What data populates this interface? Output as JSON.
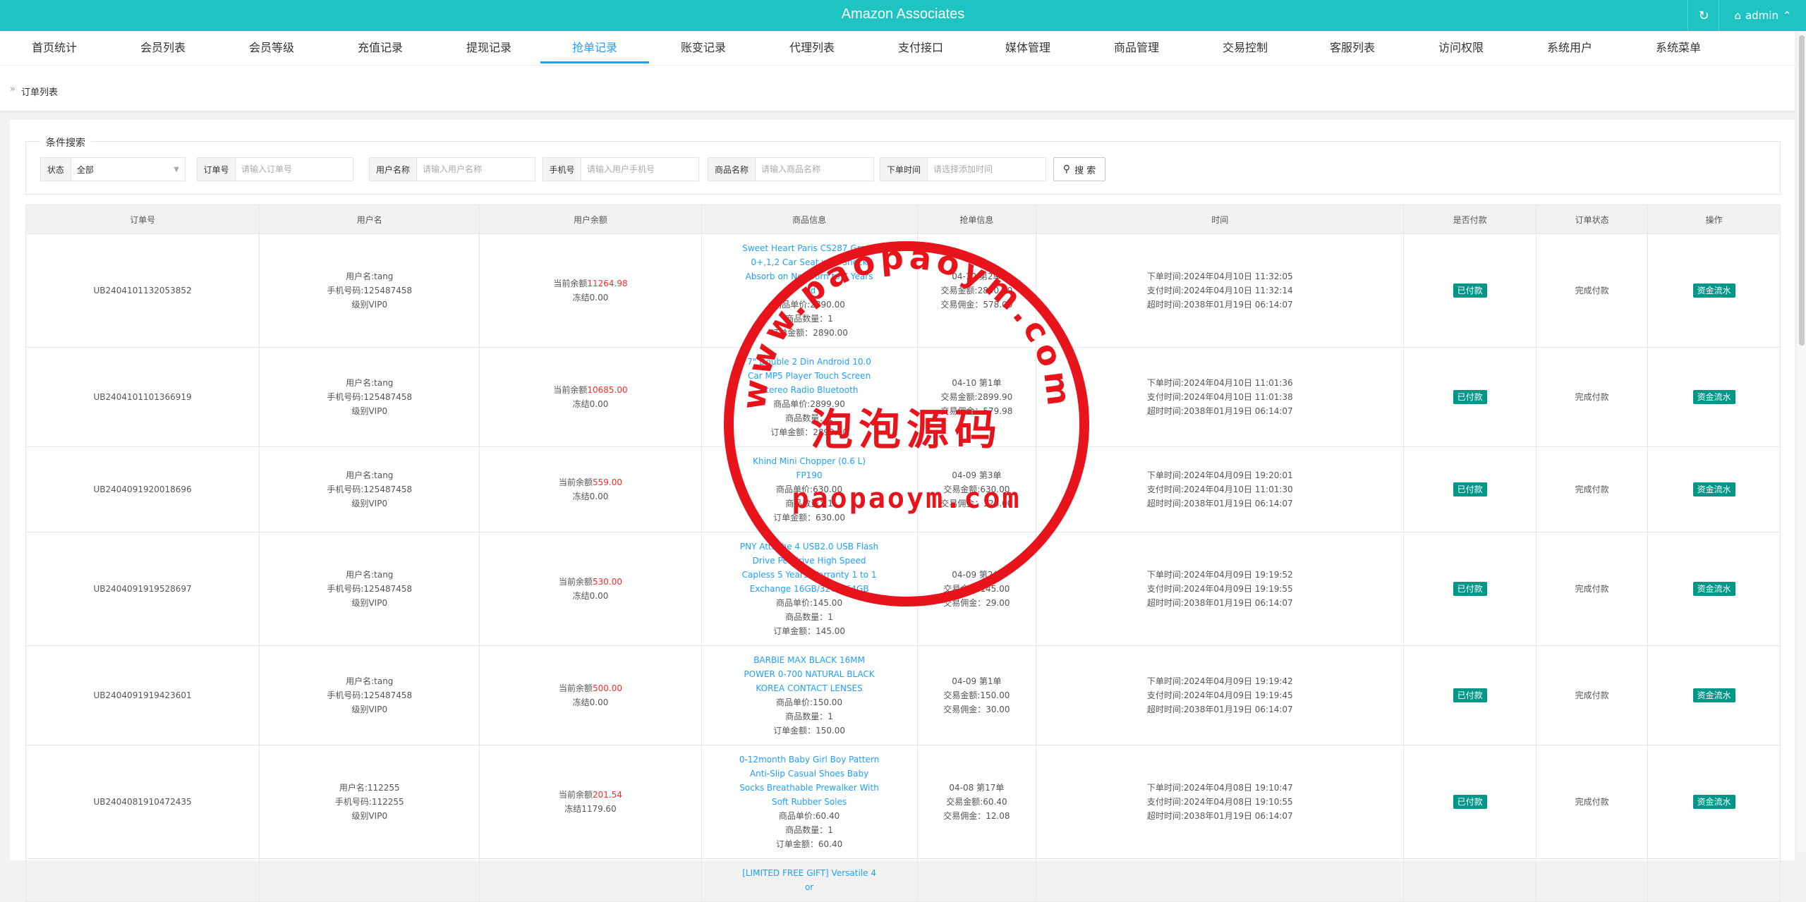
{
  "header": {
    "title": "Amazon Associates",
    "refresh_icon": "refresh-icon",
    "user_icon": "user-icon",
    "username": "admin",
    "chevron_icon": "chevron-up-icon",
    "bg_color": "#1ec4c1"
  },
  "nav": {
    "items": [
      {
        "label": "首页统计"
      },
      {
        "label": "会员列表"
      },
      {
        "label": "会员等级"
      },
      {
        "label": "充值记录"
      },
      {
        "label": "提现记录"
      },
      {
        "label": "抢单记录",
        "active": true
      },
      {
        "label": "账变记录"
      },
      {
        "label": "代理列表"
      },
      {
        "label": "支付接口"
      },
      {
        "label": "媒体管理"
      },
      {
        "label": "商品管理"
      },
      {
        "label": "交易控制"
      },
      {
        "label": "客服列表"
      },
      {
        "label": "访问权限"
      },
      {
        "label": "系统用户"
      },
      {
        "label": "系统菜单"
      }
    ],
    "active_color": "#1e9fff"
  },
  "breadcrumb": {
    "icon": "double-chevron-right-icon",
    "label": "订单列表"
  },
  "search": {
    "legend": "条件搜索",
    "status_label": "状态",
    "status_value": "全部",
    "order_label": "订单号",
    "order_placeholder": "请输入订单号",
    "username_label": "用户名称",
    "username_placeholder": "请输入用户名称",
    "phone_label": "手机号",
    "phone_placeholder": "请输入用户手机号",
    "product_label": "商品名称",
    "product_placeholder": "请输入商品名称",
    "time_label": "下单时间",
    "time_placeholder": "请选择添加时间",
    "button_label": "搜 索"
  },
  "table": {
    "headers": [
      "订单号",
      "用户名",
      "用户余额",
      "商品信息",
      "抢单信息",
      "时间",
      "是否付款",
      "订单状态",
      "操作"
    ],
    "rows": [
      {
        "order_no": "UB2404101132053852",
        "user": [
          "用户名:tang",
          "手机号码:125487458",
          "级别VIP0"
        ],
        "balance_label": "当前余额",
        "balance": "11264.98",
        "frozen": "冻结0.00",
        "product_name": "Sweet Heart Paris CS287 Group 0+,1,2 Car Seat with Shock Absorb on Newborn to 7 Years old",
        "product_lines": [
          "商品单价:2890.00",
          "商品数量：1",
          "订单金额：2890.00"
        ],
        "grab": [
          "04-10 第2单",
          "交易金额:2890.00",
          "交易佣金：578.00"
        ],
        "time": [
          "下单时间:2024年04月10日 11:32:05",
          "支付时间:2024年04月10日 11:32:14",
          "超时时间:2038年01月19日 06:14:07"
        ],
        "paid": "已付款",
        "status": "完成付款",
        "action": "资金流水"
      },
      {
        "order_no": "UB2404101101366919",
        "user": [
          "用户名:tang",
          "手机号码:125487458",
          "级别VIP0"
        ],
        "balance_label": "当前余额",
        "balance": "10685.00",
        "frozen": "冻结0.00",
        "product_name": "7\" Double 2 Din Android 10.0 Car MP5 Player Touch Screen Stereo Radio Bluetooth",
        "product_lines": [
          "商品单价:2899.90",
          "商品数量：1",
          "订单金额：2899.90"
        ],
        "grab": [
          "04-10 第1单",
          "交易金额:2899.90",
          "交易佣金：579.98"
        ],
        "time": [
          "下单时间:2024年04月10日 11:01:36",
          "支付时间:2024年04月10日 11:01:38",
          "超时时间:2038年01月19日 06:14:07"
        ],
        "paid": "已付款",
        "status": "完成付款",
        "action": "资金流水"
      },
      {
        "order_no": "UB2404091920018696",
        "user": [
          "用户名:tang",
          "手机号码:125487458",
          "级别VIP0"
        ],
        "balance_label": "当前余额",
        "balance": "559.00",
        "frozen": "冻结0.00",
        "product_name": "Khind Mini Chopper (0.6 L) FP190",
        "product_lines": [
          "商品单价:630.00",
          "商品数量：1",
          "订单金额：630.00"
        ],
        "grab": [
          "04-09 第3单",
          "交易金额:630.00",
          "交易佣金：126.00"
        ],
        "time": [
          "下单时间:2024年04月09日 19:20:01",
          "支付时间:2024年04月10日 11:01:30",
          "超时时间:2038年01月19日 06:14:07"
        ],
        "paid": "已付款",
        "status": "完成付款",
        "action": "资金流水"
      },
      {
        "order_no": "UB2404091919528697",
        "user": [
          "用户名:tang",
          "手机号码:125487458",
          "级别VIP0"
        ],
        "balance_label": "当前余额",
        "balance": "530.00",
        "frozen": "冻结0.00",
        "product_name": "PNY Attache 4 USB2.0 USB Flash Drive Pendrive High Speed Capless 5 Years Warranty 1 to 1 Exchange 16GB/32GB/64GB",
        "product_lines": [
          "商品单价:145.00",
          "商品数量：1",
          "订单金额：145.00"
        ],
        "grab": [
          "04-09 第2单",
          "交易金额:145.00",
          "交易佣金：29.00"
        ],
        "time": [
          "下单时间:2024年04月09日 19:19:52",
          "支付时间:2024年04月09日 19:19:55",
          "超时时间:2038年01月19日 06:14:07"
        ],
        "paid": "已付款",
        "status": "完成付款",
        "action": "资金流水"
      },
      {
        "order_no": "UB2404091919423601",
        "user": [
          "用户名:tang",
          "手机号码:125487458",
          "级别VIP0"
        ],
        "balance_label": "当前余额",
        "balance": "500.00",
        "frozen": "冻结0.00",
        "product_name": "BARBIE MAX BLACK 16MM POWER 0-700 NATURAL BLACK KOREA CONTACT LENSES",
        "product_lines": [
          "商品单价:150.00",
          "商品数量：1",
          "订单金额：150.00"
        ],
        "grab": [
          "04-09 第1单",
          "交易金额:150.00",
          "交易佣金：30.00"
        ],
        "time": [
          "下单时间:2024年04月09日 19:19:42",
          "支付时间:2024年04月09日 19:19:45",
          "超时时间:2038年01月19日 06:14:07"
        ],
        "paid": "已付款",
        "status": "完成付款",
        "action": "资金流水"
      },
      {
        "order_no": "UB2404081910472435",
        "user": [
          "用户名:112255",
          "手机号码:112255",
          "级别VIP0"
        ],
        "balance_label": "当前余额",
        "balance": "201.54",
        "frozen": "冻结1179.60",
        "product_name": "0-12month Baby Girl Boy Pattern Anti-Slip Casual Shoes Baby Socks Breathable Prewalker With Soft Rubber Soles",
        "product_lines": [
          "商品单价:60.40",
          "商品数量：1",
          "订单金额：60.40"
        ],
        "grab": [
          "04-08 第17单",
          "交易金额:60.40",
          "交易佣金：12.08"
        ],
        "time": [
          "下单时间:2024年04月08日 19:10:47",
          "支付时间:2024年04月08日 19:10:55",
          "超时时间:2038年01月19日 06:14:07"
        ],
        "paid": "已付款",
        "status": "完成付款",
        "action": "资金流水"
      },
      {
        "order_no": "",
        "user": [
          "",
          "",
          ""
        ],
        "balance_label": "",
        "balance": "",
        "frozen": "",
        "product_name": "[LIMITED FREE GIFT] Versatile 4 or",
        "product_lines": [
          "",
          "",
          ""
        ],
        "grab": [
          "",
          "",
          ""
        ],
        "time": [
          "",
          "",
          ""
        ],
        "paid": "",
        "status": "",
        "action": ""
      }
    ]
  },
  "watermark": {
    "url_text": "www.paopaoym.com",
    "cn_text": "泡泡源码",
    "domain_text": "paopaoym.com",
    "color": "#e8141b"
  }
}
